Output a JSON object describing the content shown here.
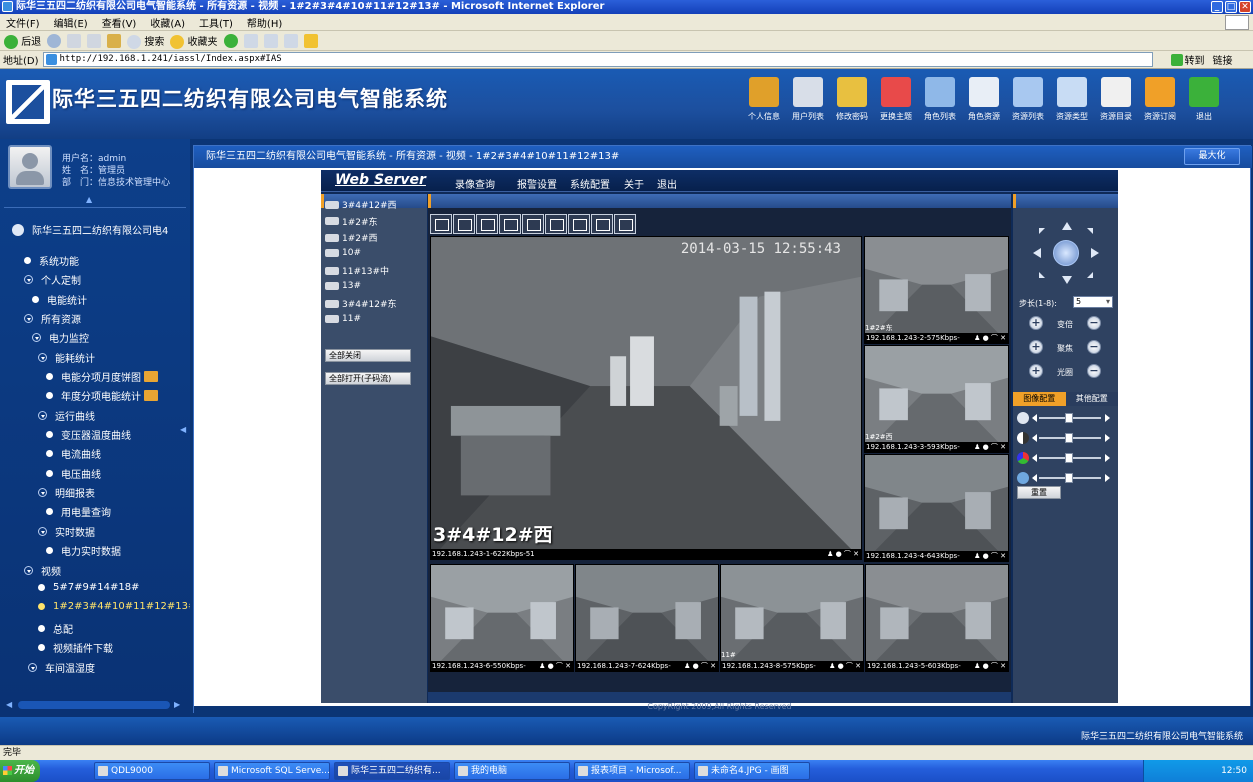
{
  "window": {
    "title": "际华三五四二纺织有限公司电气智能系统 - 所有资源 - 视频 - 1#2#3#4#10#11#12#13# - Microsoft Internet Explorer"
  },
  "menu": [
    "文件(F)",
    "编辑(E)",
    "查看(V)",
    "收藏(A)",
    "工具(T)",
    "帮助(H)"
  ],
  "toolbar": {
    "back": "后退",
    "search": "搜索",
    "favorites": "收藏夹"
  },
  "address": {
    "label": "地址(D)",
    "url": "http://192.168.1.241/iassl/Index.aspx#IAS",
    "go": "转到",
    "links": "链接"
  },
  "header": {
    "system_name": "际华三五四二纺织有限公司电气智能系统",
    "icons": [
      {
        "label": "个人信息",
        "color": "#e0a02a"
      },
      {
        "label": "用户列表",
        "color": "#d8dee8"
      },
      {
        "label": "修改密码",
        "color": "#e8c040"
      },
      {
        "label": "更换主题",
        "color": "#e84a4a"
      },
      {
        "label": "角色列表",
        "color": "#8fb8e8"
      },
      {
        "label": "角色资源",
        "color": "#e8eef6"
      },
      {
        "label": "资源列表",
        "color": "#a8c8f0"
      },
      {
        "label": "资源类型",
        "color": "#c8dcf4"
      },
      {
        "label": "资源目录",
        "color": "#f0f0f0"
      },
      {
        "label": "资源订阅",
        "color": "#f0a028"
      },
      {
        "label": "退出",
        "color": "#3bb13a"
      }
    ]
  },
  "user": {
    "name_label": "用户名：",
    "name": "admin",
    "real_label": "姓　名：",
    "real": "管理员",
    "dept_label": "部　门：",
    "dept": "信息技术管理中心"
  },
  "tree": {
    "root": "际华三五四二纺织有限公司电4",
    "items": [
      {
        "label": "系统功能"
      },
      {
        "label": "个人定制"
      },
      {
        "label": "电能统计"
      },
      {
        "label": "所有资源"
      },
      {
        "label": "电力监控"
      },
      {
        "label": "能耗统计"
      },
      {
        "label": "电能分项月度饼图"
      },
      {
        "label": "年度分项电能统计"
      },
      {
        "label": "运行曲线"
      },
      {
        "label": "变压器温度曲线"
      },
      {
        "label": "电流曲线"
      },
      {
        "label": "电压曲线"
      },
      {
        "label": "明细报表"
      },
      {
        "label": "用电量查询"
      },
      {
        "label": "实时数据"
      },
      {
        "label": "电力实时数据"
      },
      {
        "label": "视频"
      },
      {
        "label": "5#7#9#14#18#"
      },
      {
        "label": "1#2#3#4#10#11#12#13#"
      },
      {
        "label": "总配"
      },
      {
        "label": "视频插件下载"
      },
      {
        "label": "车间温湿度"
      }
    ]
  },
  "content": {
    "breadcrumb": "际华三五四二纺织有限公司电气智能系统 - 所有资源 - 视频 - 1#2#3#4#10#11#12#13#",
    "maximize": "最大化",
    "copyright": "CopyRight 2009,All Rights Reserved"
  },
  "webserver": {
    "title": "Web Server",
    "menu": [
      "录像查询",
      "报警设置",
      "系统配置",
      "关于",
      "退出"
    ],
    "cameras": [
      "3#4#12#西",
      "1#2#东",
      "1#2#西",
      "10#",
      "11#13#中",
      "13#",
      "3#4#12#东",
      "11#"
    ],
    "close_all": "全部关闭",
    "open_all": "全部打开(子码流)"
  },
  "video": {
    "timestamp": "2014-03-15  12:55:43",
    "main_name": "3#4#12#西",
    "main_caption": "192.168.1.243-1-622Kbps-51",
    "side": [
      {
        "label": "1#2#东",
        "caption": "192.168.1.243-2-575Kbps-"
      },
      {
        "label": "1#2#西",
        "caption": "192.168.1.243-3-593Kbps-"
      },
      {
        "label": "",
        "caption": "192.168.1.243-4-643Kbps-"
      }
    ],
    "bottom": [
      {
        "caption": "192.168.1.243-6-550Kbps-"
      },
      {
        "caption": "192.168.1.243-7-624Kbps-"
      },
      {
        "label": "11#",
        "caption": "192.168.1.243-8-575Kbps-"
      },
      {
        "caption": "192.168.1.243-5-603Kbps-"
      }
    ],
    "controls": "♟ ● ⌒ ✕"
  },
  "ptz": {
    "step_label": "步长(1-8):",
    "step_value": "5",
    "zoom": "变倍",
    "focus": "聚焦",
    "iris": "光圈",
    "tab_image": "图像配置",
    "tab_other": "其他配置",
    "reset": "重置"
  },
  "footer": {
    "company": "际华三五四二纺织有限公司电气智能系统"
  },
  "status": {
    "text": "完毕"
  },
  "taskbar": {
    "start": "开始",
    "buttons": [
      "QDL9000",
      "Microsoft SQL Serve...",
      "际华三五四二纺织有...",
      "我的电脑",
      "报表项目 - Microsof...",
      "未命名4.JPG - 画图"
    ],
    "clock": "12:50"
  }
}
